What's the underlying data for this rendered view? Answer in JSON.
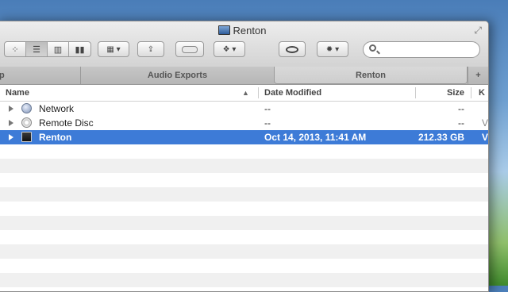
{
  "window": {
    "title": "Renton"
  },
  "toolbar": {
    "view_icons": [
      "icon-view-icon",
      "list-view-icon",
      "column-view-icon",
      "coverflow-view-icon"
    ],
    "arrange_icon": "arrange-grid-icon",
    "share_icon": "share-icon",
    "tag_icon": "tag-icon",
    "dropbox_icon": "dropbox-icon",
    "quicklook_icon": "eye-icon",
    "action_icon": "gear-icon",
    "search": {
      "value": "",
      "placeholder": ""
    }
  },
  "tabs": [
    {
      "label": "p"
    },
    {
      "label": "Audio Exports"
    },
    {
      "label": "Renton"
    },
    {
      "label": "+"
    }
  ],
  "columns": {
    "name": "Name",
    "date_modified": "Date Modified",
    "size": "Size",
    "kind": "K"
  },
  "rows": [
    {
      "name": "Network",
      "date": "--",
      "size": "--",
      "kind": "",
      "selected": false
    },
    {
      "name": "Remote Disc",
      "date": "--",
      "size": "--",
      "kind": "V",
      "selected": false
    },
    {
      "name": "Renton",
      "date": "Oct 14, 2013, 11:41 AM",
      "size": "212.33 GB",
      "kind": "V",
      "selected": true
    }
  ],
  "colors": {
    "selection": "#3d7bd7",
    "alt_row": "#f0f0f0"
  }
}
